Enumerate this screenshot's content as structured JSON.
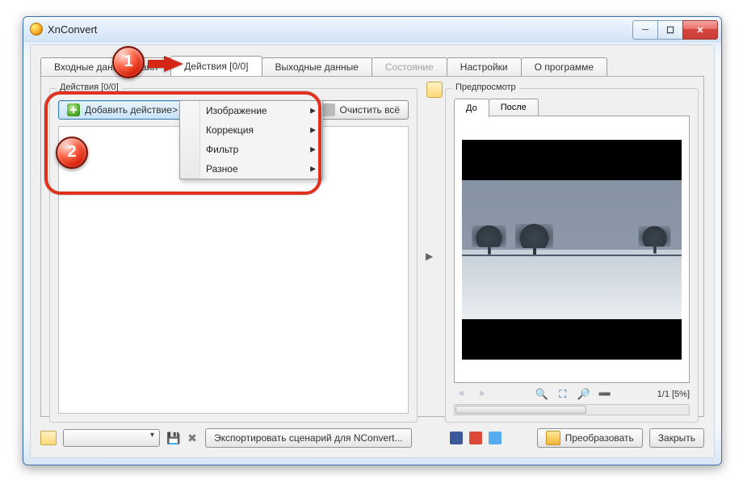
{
  "window": {
    "title": "XnConvert"
  },
  "tabs": {
    "input_files": "Входные данные файл",
    "actions": "Действия [0/0]",
    "output": "Выходные данные",
    "status": "Состояние",
    "settings": "Настройки",
    "about": "О программе"
  },
  "actions_panel": {
    "legend": "Действия [0/0]",
    "add_action": "Добавить действие>",
    "clear_all": "Очистить всё",
    "menu": {
      "image": "Изображение",
      "correction": "Коррекция",
      "filter": "Фильтр",
      "misc": "Разное"
    }
  },
  "preview": {
    "legend": "Предпросмотр",
    "tab_before": "До",
    "tab_after": "После",
    "counter": "1/1 [5%]"
  },
  "footer": {
    "export_script": "Экспортировать сценарий для NConvert...",
    "convert": "Преобразовать",
    "close": "Закрыть"
  },
  "callouts": {
    "one": "1",
    "two": "2"
  }
}
